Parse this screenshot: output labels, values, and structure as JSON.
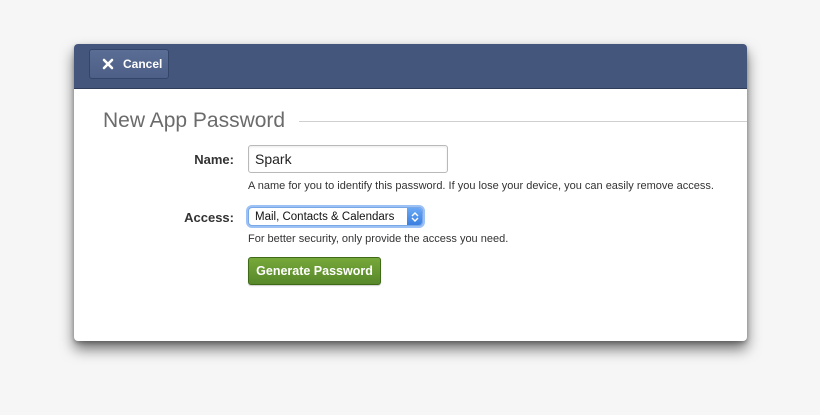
{
  "header": {
    "cancel_label": "Cancel",
    "cancel_icon": "close-icon"
  },
  "form": {
    "title": "New App Password",
    "name": {
      "label": "Name:",
      "value": "Spark",
      "help": "A name for you to identify this password. If you lose your device, you can easily remove access."
    },
    "access": {
      "label": "Access:",
      "selected": "Mail, Contacts & Calendars",
      "help": "For better security, only provide the access you need."
    },
    "generate_label": "Generate Password"
  },
  "colors": {
    "header_bg": "#44567c",
    "generate_button": "#67982f",
    "select_focus": "#7aa7e8"
  }
}
